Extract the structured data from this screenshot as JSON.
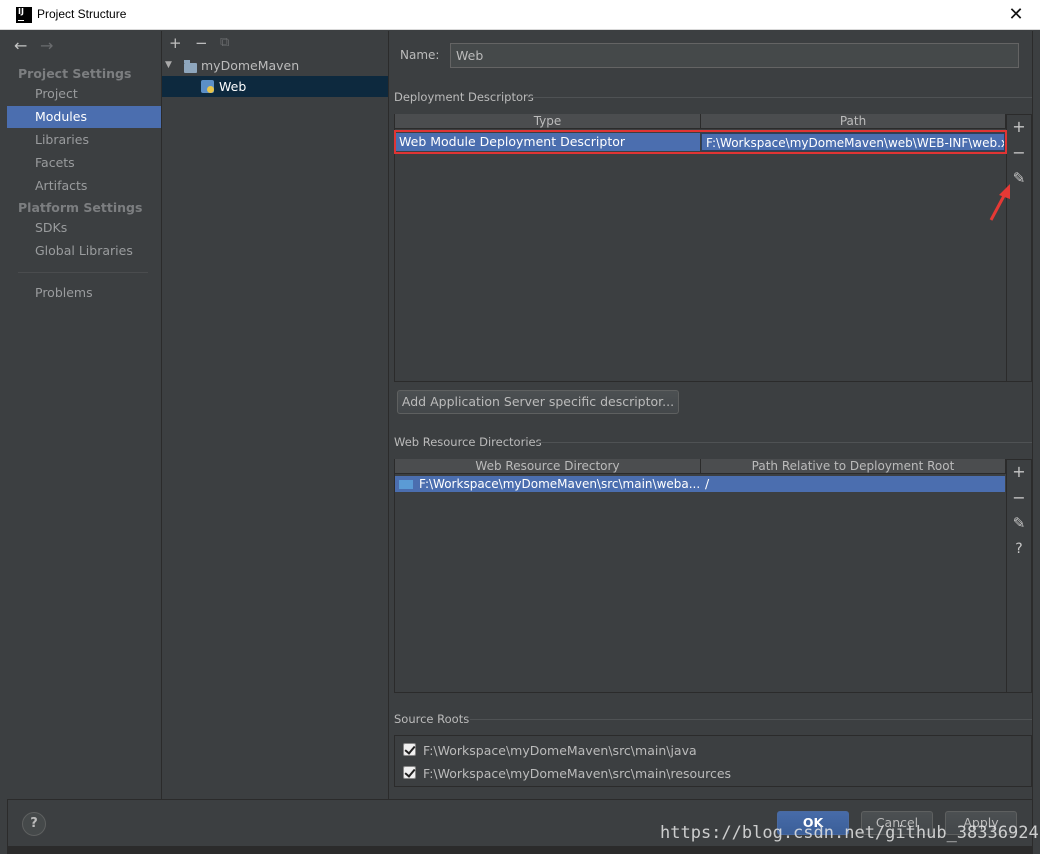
{
  "window": {
    "title": "Project Structure",
    "close_glyph": "✕",
    "app_icon_text": "IJ"
  },
  "nav": {
    "back_glyph": "←",
    "forward_glyph": "→",
    "sections": [
      {
        "title": "Project Settings",
        "items": [
          "Project",
          "Modules",
          "Libraries",
          "Facets",
          "Artifacts"
        ]
      },
      {
        "title": "Platform Settings",
        "items": [
          "SDKs",
          "Global Libraries"
        ]
      }
    ],
    "problems": "Problems",
    "selected": "Modules"
  },
  "tree": {
    "toolbar": {
      "add": "+",
      "remove": "−",
      "copy": "⧉"
    },
    "root": "myDomeMaven",
    "child": "Web",
    "expand_glyph": "▼"
  },
  "facet": {
    "name_label": "Name:",
    "name_value": "Web"
  },
  "deployment": {
    "title": "Deployment Descriptors",
    "columns": [
      "Type",
      "Path"
    ],
    "rows": [
      {
        "type": "Web Module Deployment Descriptor",
        "path": "F:\\Workspace\\myDomeMaven\\web\\WEB-INF\\web.xml"
      }
    ],
    "add_server_button": "Add Application Server specific descriptor..."
  },
  "resources": {
    "title": "Web Resource Directories",
    "columns": [
      "Web Resource Directory",
      "Path Relative to Deployment Root"
    ],
    "rows": [
      {
        "dir": "F:\\Workspace\\myDomeMaven\\src\\main\\weba...",
        "path": "/"
      }
    ]
  },
  "side_tools": {
    "add": "+",
    "remove": "−",
    "edit": "✎",
    "help": "?"
  },
  "source_roots": {
    "title": "Source Roots",
    "items": [
      {
        "path": "F:\\Workspace\\myDomeMaven\\src\\main\\java",
        "checked": true
      },
      {
        "path": "F:\\Workspace\\myDomeMaven\\src\\main\\resources",
        "checked": true
      }
    ]
  },
  "footer": {
    "help": "?",
    "ok": "OK",
    "cancel": "Cancel",
    "apply": "Apply"
  },
  "watermark": "https://blog.csdn.net/github_38336924",
  "colors": {
    "accent": "#4b6eaf",
    "annotation": "#e53935",
    "background": "#3c3f41"
  }
}
